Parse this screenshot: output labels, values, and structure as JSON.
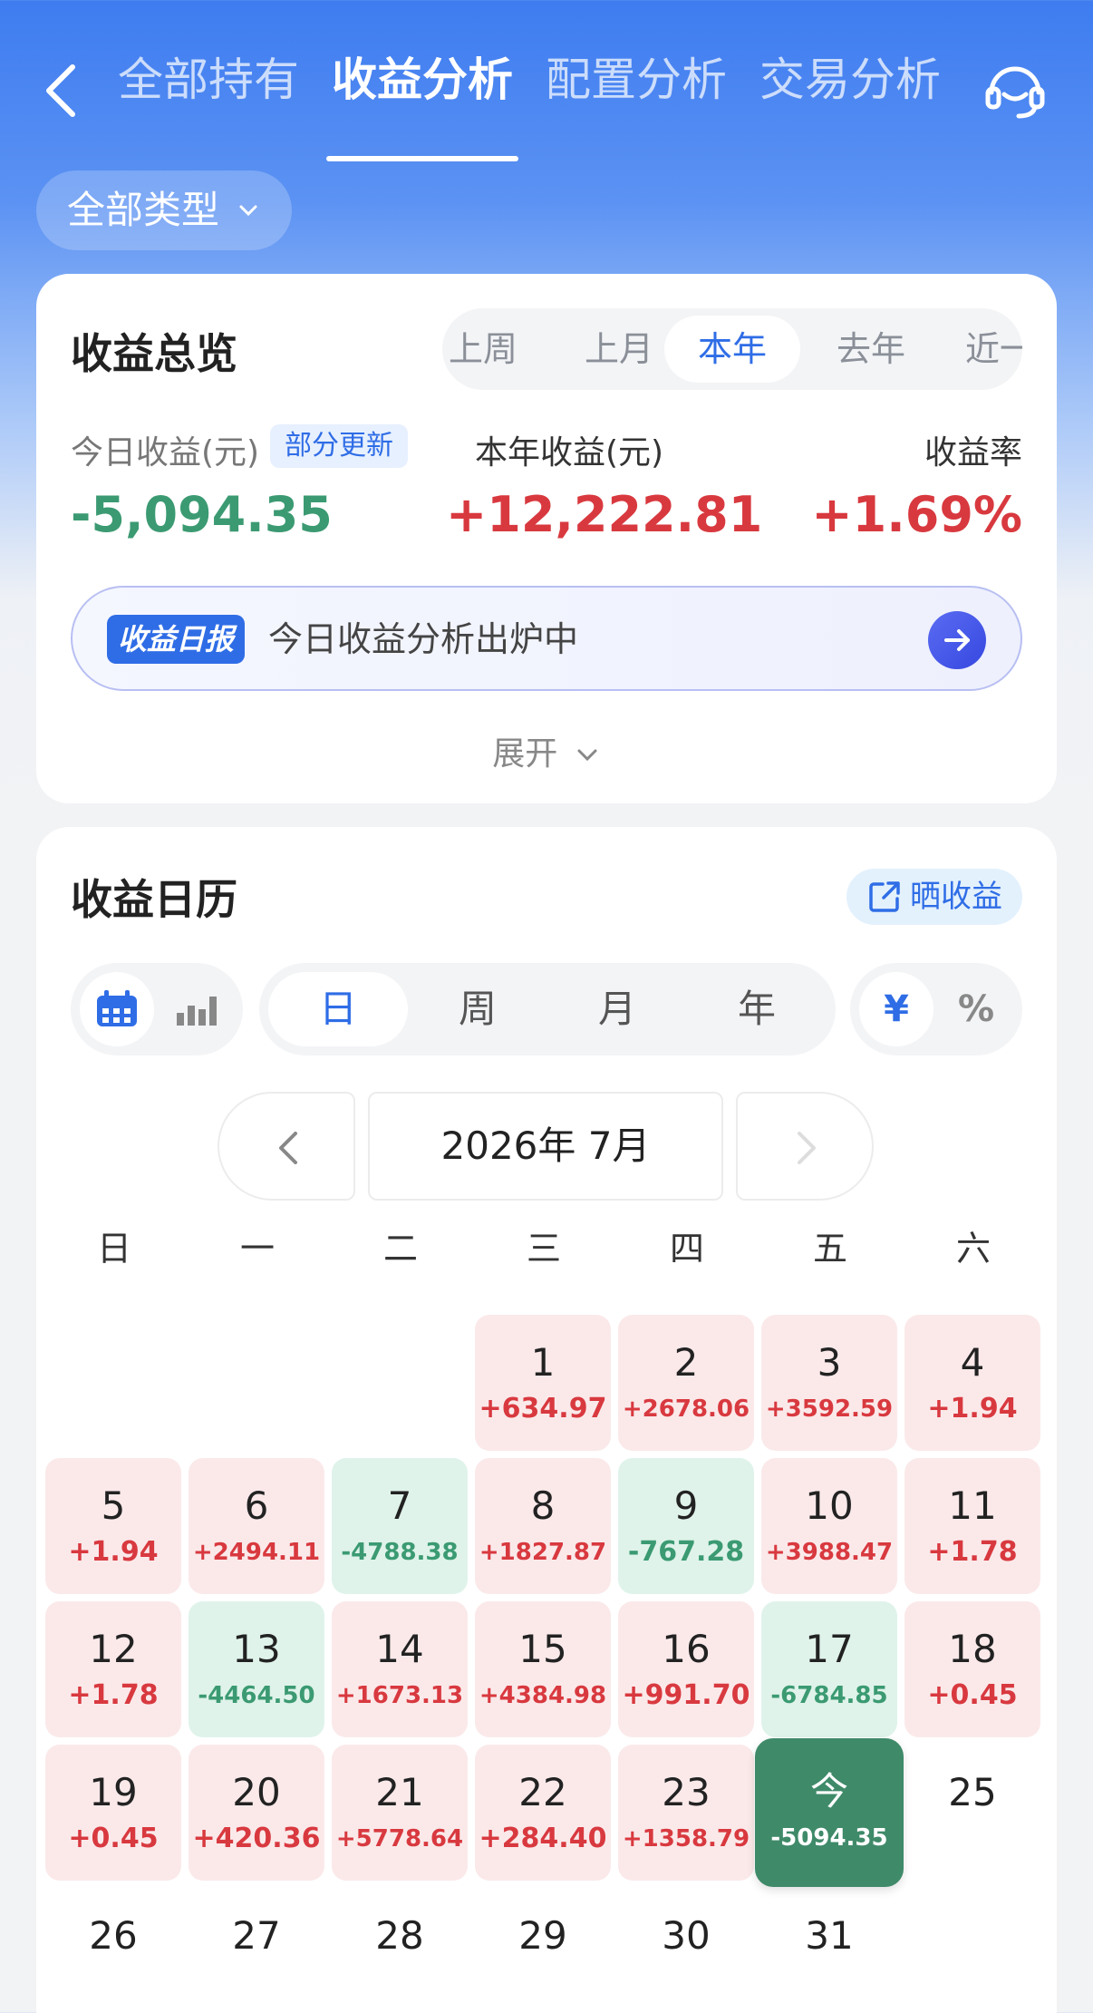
{
  "nav": {
    "tabs": [
      "全部持有",
      "收益分析",
      "配置分析",
      "交易分析"
    ],
    "active_tab": 1
  },
  "filter": {
    "type_label": "全部类型"
  },
  "overview": {
    "title": "收益总览",
    "periods": [
      "上周",
      "上月",
      "本年",
      "去年",
      "近一"
    ],
    "visible_periods": [
      "上周",
      "上月",
      "本年",
      "去年",
      "近一"
    ],
    "active_period": "本年",
    "today_label": "今日收益(元)",
    "partial_badge": "部分更新",
    "today_value": "-5,094.35",
    "year_label": "本年收益(元)",
    "year_value": "+12,222.81",
    "rate_label": "收益率",
    "rate_value": "+1.69%",
    "daily_tag": "收益日报",
    "daily_text": "今日收益分析出炉中",
    "expand_label": "展开"
  },
  "calendar": {
    "title": "收益日历",
    "share_label": "晒收益",
    "granularity": [
      "日",
      "周",
      "月",
      "年"
    ],
    "active_granularity": "日",
    "units": [
      "¥",
      "%"
    ],
    "active_unit": "¥",
    "month_label": "2026年 7月",
    "weekdays": [
      "日",
      "一",
      "二",
      "三",
      "四",
      "五",
      "六"
    ],
    "days": [
      {
        "d": "1",
        "v": "+634.97",
        "s": "up"
      },
      {
        "d": "2",
        "v": "+2678.06",
        "s": "up"
      },
      {
        "d": "3",
        "v": "+3592.59",
        "s": "up"
      },
      {
        "d": "4",
        "v": "+1.94",
        "s": "up"
      },
      {
        "d": "5",
        "v": "+1.94",
        "s": "up"
      },
      {
        "d": "6",
        "v": "+2494.11",
        "s": "up"
      },
      {
        "d": "7",
        "v": "-4788.38",
        "s": "down"
      },
      {
        "d": "8",
        "v": "+1827.87",
        "s": "up"
      },
      {
        "d": "9",
        "v": "-767.28",
        "s": "down"
      },
      {
        "d": "10",
        "v": "+3988.47",
        "s": "up"
      },
      {
        "d": "11",
        "v": "+1.78",
        "s": "up"
      },
      {
        "d": "12",
        "v": "+1.78",
        "s": "up"
      },
      {
        "d": "13",
        "v": "-4464.50",
        "s": "down"
      },
      {
        "d": "14",
        "v": "+1673.13",
        "s": "up"
      },
      {
        "d": "15",
        "v": "+4384.98",
        "s": "up"
      },
      {
        "d": "16",
        "v": "+991.70",
        "s": "up"
      },
      {
        "d": "17",
        "v": "-6784.85",
        "s": "down"
      },
      {
        "d": "18",
        "v": "+0.45",
        "s": "up"
      },
      {
        "d": "19",
        "v": "+0.45",
        "s": "up"
      },
      {
        "d": "20",
        "v": "+420.36",
        "s": "up"
      },
      {
        "d": "21",
        "v": "+5778.64",
        "s": "up"
      },
      {
        "d": "22",
        "v": "+284.40",
        "s": "up"
      },
      {
        "d": "23",
        "v": "+1358.79",
        "s": "up"
      },
      {
        "d": "今",
        "v": "-5094.35",
        "s": "today"
      },
      {
        "d": "25",
        "v": "",
        "s": "none"
      },
      {
        "d": "26",
        "v": "",
        "s": "none"
      },
      {
        "d": "27",
        "v": "",
        "s": "none"
      },
      {
        "d": "28",
        "v": "",
        "s": "none"
      },
      {
        "d": "29",
        "v": "",
        "s": "none"
      },
      {
        "d": "30",
        "v": "",
        "s": "none"
      },
      {
        "d": "31",
        "v": "",
        "s": "none"
      }
    ]
  }
}
